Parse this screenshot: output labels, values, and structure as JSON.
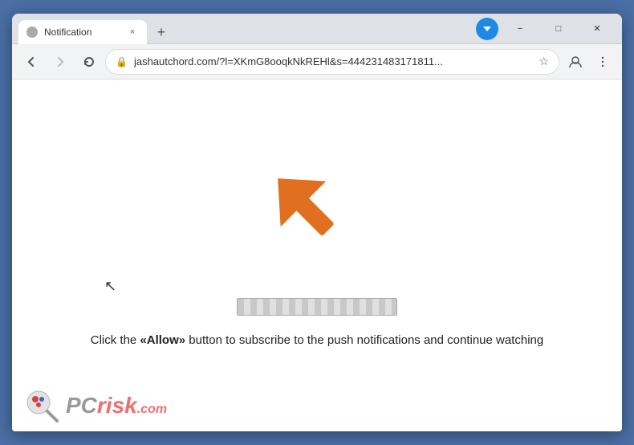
{
  "window": {
    "title": "Notification",
    "tab_close_label": "×",
    "new_tab_label": "+",
    "minimize_label": "−",
    "maximize_label": "□",
    "close_label": "✕"
  },
  "toolbar": {
    "url": "jashautchord.com/?l=XKmG8ooqkNkREHl&s=444231483171811...",
    "back_label": "←",
    "forward_label": "→",
    "reload_label": "↺",
    "star_label": "☆",
    "lock_label": "🔒"
  },
  "page": {
    "message_prefix": "Click the ",
    "message_allow": "«Allow»",
    "message_suffix": " button to subscribe to the push notifications and continue watching",
    "watermark": "PCrisk.com"
  }
}
